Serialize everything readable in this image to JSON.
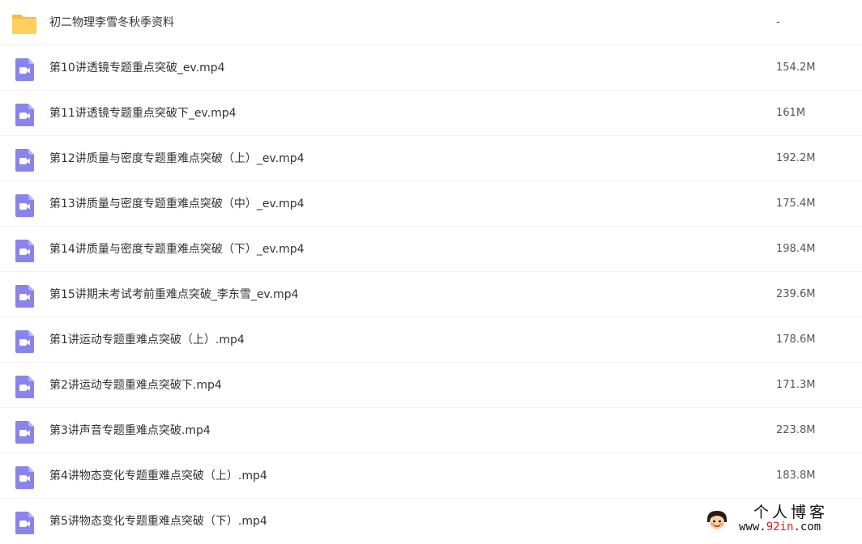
{
  "colors": {
    "folder_icon": "#fdcf5c",
    "video_icon": "#8a83ec",
    "row_divider": "#f1f2f5",
    "watermark_accent": "#d9241c"
  },
  "files": [
    {
      "icon": "folder-icon",
      "name": "初二物理李雪冬秋季资料",
      "size": "-"
    },
    {
      "icon": "video-file-icon",
      "name": "第10讲透镜专题重点突破_ev.mp4",
      "size": "154.2M"
    },
    {
      "icon": "video-file-icon",
      "name": "第11讲透镜专题重点突破下_ev.mp4",
      "size": "161M"
    },
    {
      "icon": "video-file-icon",
      "name": "第12讲质量与密度专题重难点突破（上）_ev.mp4",
      "size": "192.2M"
    },
    {
      "icon": "video-file-icon",
      "name": "第13讲质量与密度专题重难点突破（中）_ev.mp4",
      "size": "175.4M"
    },
    {
      "icon": "video-file-icon",
      "name": "第14讲质量与密度专题重难点突破（下）_ev.mp4",
      "size": "198.4M"
    },
    {
      "icon": "video-file-icon",
      "name": "第15讲期末考试考前重难点突破_李东雪_ev.mp4",
      "size": "239.6M"
    },
    {
      "icon": "video-file-icon",
      "name": "第1讲运动专题重难点突破（上）.mp4",
      "size": "178.6M"
    },
    {
      "icon": "video-file-icon",
      "name": "第2讲运动专题重难点突破下.mp4",
      "size": "171.3M"
    },
    {
      "icon": "video-file-icon",
      "name": "第3讲声音专题重难点突破.mp4",
      "size": "223.8M"
    },
    {
      "icon": "video-file-icon",
      "name": "第4讲物态变化专题重难点突破（上）.mp4",
      "size": "183.8M"
    },
    {
      "icon": "video-file-icon",
      "name": "第5讲物态变化专题重难点突破（下）.mp4",
      "size": ""
    }
  ],
  "watermark": {
    "title": "个人博客",
    "url_prefix": "www.",
    "url_accent": "92in",
    "url_suffix": ".com"
  }
}
